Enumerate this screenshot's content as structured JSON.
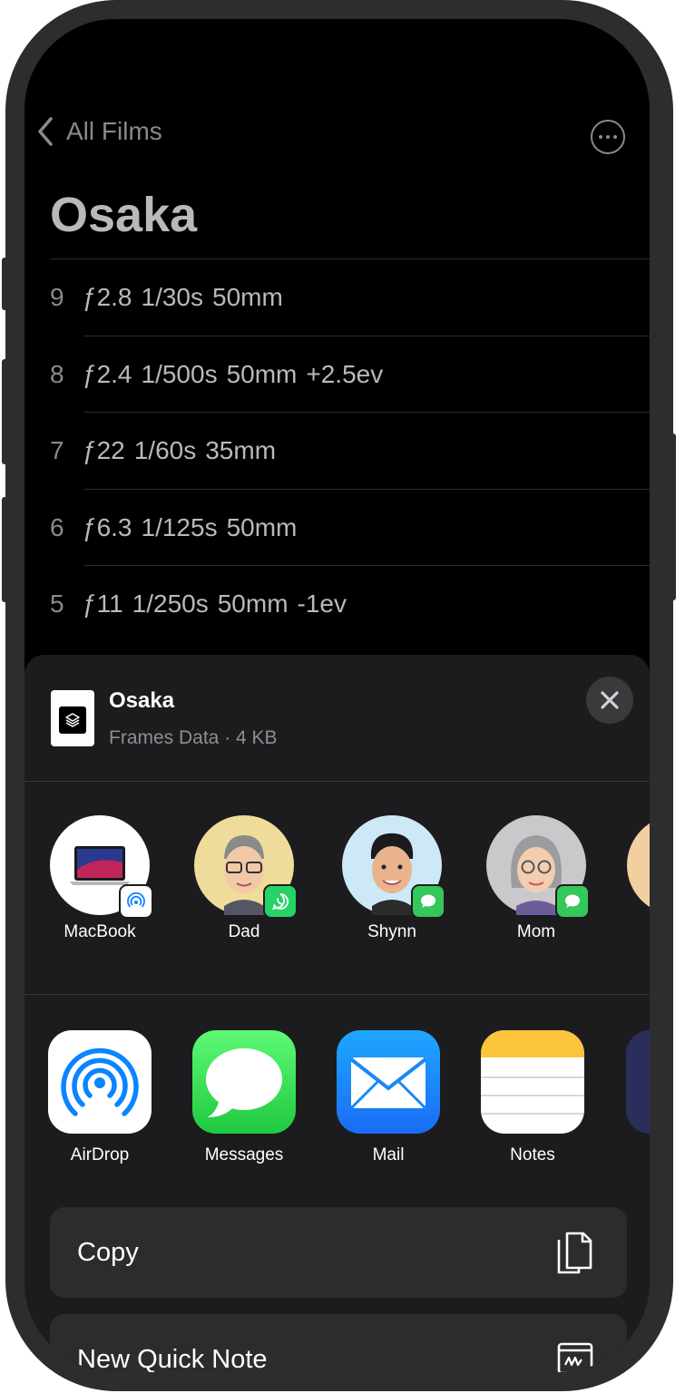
{
  "nav": {
    "back_label": "All Films",
    "back_icon": "chevron-left-icon",
    "more_icon": "ellipsis-circle-icon"
  },
  "film": {
    "title": "Osaka"
  },
  "frames": [
    {
      "number": "9",
      "aperture": "ƒ2.8",
      "shutter": "1/30s",
      "focal": "50mm",
      "ev": ""
    },
    {
      "number": "8",
      "aperture": "ƒ2.4",
      "shutter": "1/500s",
      "focal": "50mm",
      "ev": "+2.5ev"
    },
    {
      "number": "7",
      "aperture": "ƒ22",
      "shutter": "1/60s",
      "focal": "35mm",
      "ev": ""
    },
    {
      "number": "6",
      "aperture": "ƒ6.3",
      "shutter": "1/125s",
      "focal": "50mm",
      "ev": ""
    },
    {
      "number": "5",
      "aperture": "ƒ11",
      "shutter": "1/250s",
      "focal": "50mm",
      "ev": "-1ev"
    }
  ],
  "share": {
    "file_name": "Osaka",
    "file_meta": "Frames Data · 4 KB",
    "contacts": [
      {
        "name": "MacBook",
        "badge": "airdrop",
        "badge_color": "#ffffff"
      },
      {
        "name": "Dad",
        "badge": "whatsapp",
        "badge_color": "#25d366"
      },
      {
        "name": "Shynn",
        "badge": "messages",
        "badge_color": "#34c759"
      },
      {
        "name": "Mom",
        "badge": "messages",
        "badge_color": "#34c759"
      }
    ],
    "apps": [
      {
        "name": "AirDrop"
      },
      {
        "name": "Messages"
      },
      {
        "name": "Mail"
      },
      {
        "name": "Notes"
      }
    ],
    "actions": [
      {
        "label": "Copy",
        "icon": "copy-icon"
      },
      {
        "label": "New Quick Note",
        "icon": "quick-note-icon"
      }
    ]
  },
  "colors": {
    "background": "#000000",
    "sheet": "#1c1c1e",
    "row_button": "#2c2c2e",
    "text_dim": "#b9b9bc",
    "accent_blue": "#0a84ff",
    "green": "#34c759"
  }
}
